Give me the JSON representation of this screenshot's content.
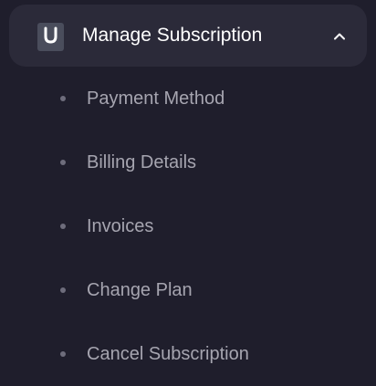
{
  "menu": {
    "header": {
      "label": "Manage Subscription",
      "icon": "subscription-u-icon",
      "expand_icon": "chevron-up-icon",
      "expanded": true
    },
    "items": [
      {
        "label": "Payment Method"
      },
      {
        "label": "Billing Details"
      },
      {
        "label": "Invoices"
      },
      {
        "label": "Change Plan"
      },
      {
        "label": "Cancel Subscription"
      }
    ]
  },
  "colors": {
    "background": "#1f1e2c",
    "header_background": "#2b2a39",
    "header_text": "#ffffff",
    "item_text": "#a6a5b0",
    "bullet": "#6e6d7c",
    "icon_background": "#4a4d5c"
  }
}
